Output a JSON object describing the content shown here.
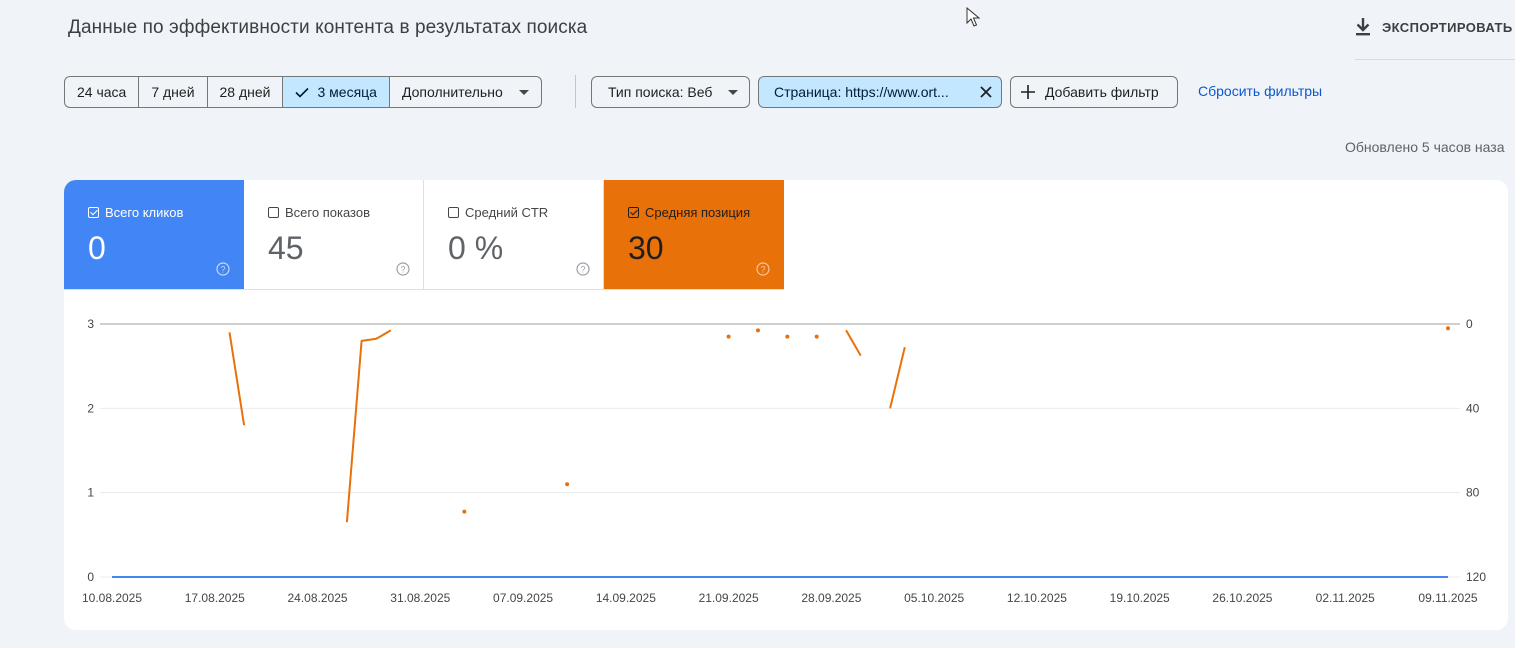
{
  "page": {
    "title": "Данные по эффективности контента в результатах поиска",
    "export_label": "ЭКСПОРТИРОВАТЬ",
    "updated_text": "Обновлено 5 часов наза"
  },
  "date_range": {
    "options": [
      {
        "label": "24 часа",
        "selected": false
      },
      {
        "label": "7 дней",
        "selected": false
      },
      {
        "label": "28 дней",
        "selected": false
      },
      {
        "label": "3 месяца",
        "selected": true
      }
    ],
    "more_label": "Дополнительно"
  },
  "filters": {
    "search_type_label": "Тип поиска: Веб",
    "page_filter_label": "Страница: https://www.ort...",
    "add_filter_label": "Добавить фильтр",
    "reset_label": "Сбросить фильтры"
  },
  "metrics": [
    {
      "label": "Всего кликов",
      "value": "0",
      "checked": true,
      "color": "#4285f4"
    },
    {
      "label": "Всего показов",
      "value": "45",
      "checked": false,
      "color": "#5e35b1"
    },
    {
      "label": "Средний CTR",
      "value": "0 %",
      "checked": false,
      "color": "#00897b"
    },
    {
      "label": "Средняя позиция",
      "value": "30",
      "checked": true,
      "color": "#e8710a"
    }
  ],
  "colors": {
    "clicks": "#4285f4",
    "position": "#e8710a",
    "accent": "#0b57d0",
    "selected_chip": "#c2e7ff"
  },
  "icons": [
    "download-icon",
    "check-icon",
    "dropdown-arrow-icon",
    "close-icon",
    "plus-icon",
    "help-icon",
    "mouse-cursor-icon"
  ],
  "chart_data": {
    "type": "line",
    "x_dates": [
      "10.08.2025",
      "11.08.2025",
      "12.08.2025",
      "13.08.2025",
      "14.08.2025",
      "15.08.2025",
      "16.08.2025",
      "17.08.2025",
      "18.08.2025",
      "19.08.2025",
      "20.08.2025",
      "21.08.2025",
      "22.08.2025",
      "23.08.2025",
      "24.08.2025",
      "25.08.2025",
      "26.08.2025",
      "27.08.2025",
      "28.08.2025",
      "29.08.2025",
      "30.08.2025",
      "31.08.2025",
      "01.09.2025",
      "02.09.2025",
      "03.09.2025",
      "04.09.2025",
      "05.09.2025",
      "06.09.2025",
      "07.09.2025",
      "08.09.2025",
      "09.09.2025",
      "10.09.2025",
      "11.09.2025",
      "12.09.2025",
      "13.09.2025",
      "14.09.2025",
      "15.09.2025",
      "16.09.2025",
      "17.09.2025",
      "18.09.2025",
      "19.09.2025",
      "20.09.2025",
      "21.09.2025",
      "22.09.2025",
      "23.09.2025",
      "24.09.2025",
      "25.09.2025",
      "26.09.2025",
      "27.09.2025",
      "28.09.2025",
      "29.09.2025",
      "30.09.2025",
      "01.10.2025",
      "02.10.2025",
      "03.10.2025",
      "04.10.2025",
      "05.10.2025",
      "06.10.2025",
      "07.10.2025",
      "08.10.2025",
      "09.10.2025",
      "10.10.2025",
      "11.10.2025",
      "12.10.2025",
      "13.10.2025",
      "14.10.2025",
      "15.10.2025",
      "16.10.2025",
      "17.10.2025",
      "18.10.2025",
      "19.10.2025",
      "20.10.2025",
      "21.10.2025",
      "22.10.2025",
      "23.10.2025",
      "24.10.2025",
      "25.10.2025",
      "26.10.2025",
      "27.10.2025",
      "28.10.2025",
      "29.10.2025",
      "30.10.2025",
      "31.10.2025",
      "01.11.2025",
      "02.11.2025",
      "03.11.2025",
      "04.11.2025",
      "05.11.2025",
      "06.11.2025",
      "07.11.2025",
      "08.11.2025",
      "09.11.2025"
    ],
    "x_tick_labels": [
      "10.08.2025",
      "17.08.2025",
      "24.08.2025",
      "31.08.2025",
      "07.09.2025",
      "14.09.2025",
      "21.09.2025",
      "28.09.2025",
      "05.10.2025",
      "12.10.2025",
      "19.10.2025",
      "26.10.2025",
      "02.11.2025",
      "09.11.2025"
    ],
    "y_left": {
      "ticks": [
        "0",
        "1",
        "2",
        "3"
      ],
      "range": [
        0,
        3
      ]
    },
    "y_right": {
      "ticks": [
        "0",
        "40",
        "80",
        "120"
      ],
      "range": [
        0,
        120
      ],
      "inverted": true
    },
    "grid": true,
    "series": [
      {
        "name": "Всего кликов",
        "axis": "left",
        "values": [
          0,
          0,
          0,
          0,
          0,
          0,
          0,
          0,
          0,
          0,
          0,
          0,
          0,
          0,
          0,
          0,
          0,
          0,
          0,
          0,
          0,
          0,
          0,
          0,
          0,
          0,
          0,
          0,
          0,
          0,
          0,
          0,
          0,
          0,
          0,
          0,
          0,
          0,
          0,
          0,
          0,
          0,
          0,
          0,
          0,
          0,
          0,
          0,
          0,
          0,
          0,
          0,
          0,
          0,
          0,
          0,
          0,
          0,
          0,
          0,
          0,
          0,
          0,
          0,
          0,
          0,
          0,
          0,
          0,
          0,
          0,
          0,
          0,
          0,
          0,
          0,
          0,
          0,
          0,
          0,
          0,
          0,
          0,
          0,
          0,
          0,
          0,
          0,
          0,
          0,
          0,
          0
        ]
      },
      {
        "name": "Средняя позиция",
        "axis": "right",
        "values": [
          null,
          null,
          null,
          null,
          null,
          null,
          null,
          null,
          4,
          48,
          null,
          null,
          null,
          null,
          null,
          null,
          94,
          8,
          7,
          3,
          null,
          null,
          null,
          null,
          89,
          null,
          null,
          null,
          null,
          null,
          null,
          76,
          null,
          null,
          null,
          null,
          null,
          null,
          null,
          null,
          null,
          null,
          6,
          null,
          3,
          null,
          6,
          null,
          6,
          null,
          3,
          15,
          null,
          40,
          11,
          null,
          null,
          null,
          null,
          null,
          null,
          null,
          null,
          null,
          null,
          null,
          null,
          null,
          null,
          null,
          null,
          null,
          null,
          null,
          null,
          null,
          null,
          null,
          null,
          null,
          null,
          null,
          null,
          null,
          null,
          null,
          null,
          null,
          null,
          null,
          null,
          2,
          null,
          null,
          null,
          null,
          null,
          null,
          null,
          null,
          null,
          null,
          null,
          null,
          null,
          null,
          null,
          null,
          null,
          null,
          null,
          null,
          null,
          null,
          null,
          null,
          null,
          null,
          null,
          null,
          null,
          null,
          null,
          null
        ]
      }
    ]
  }
}
